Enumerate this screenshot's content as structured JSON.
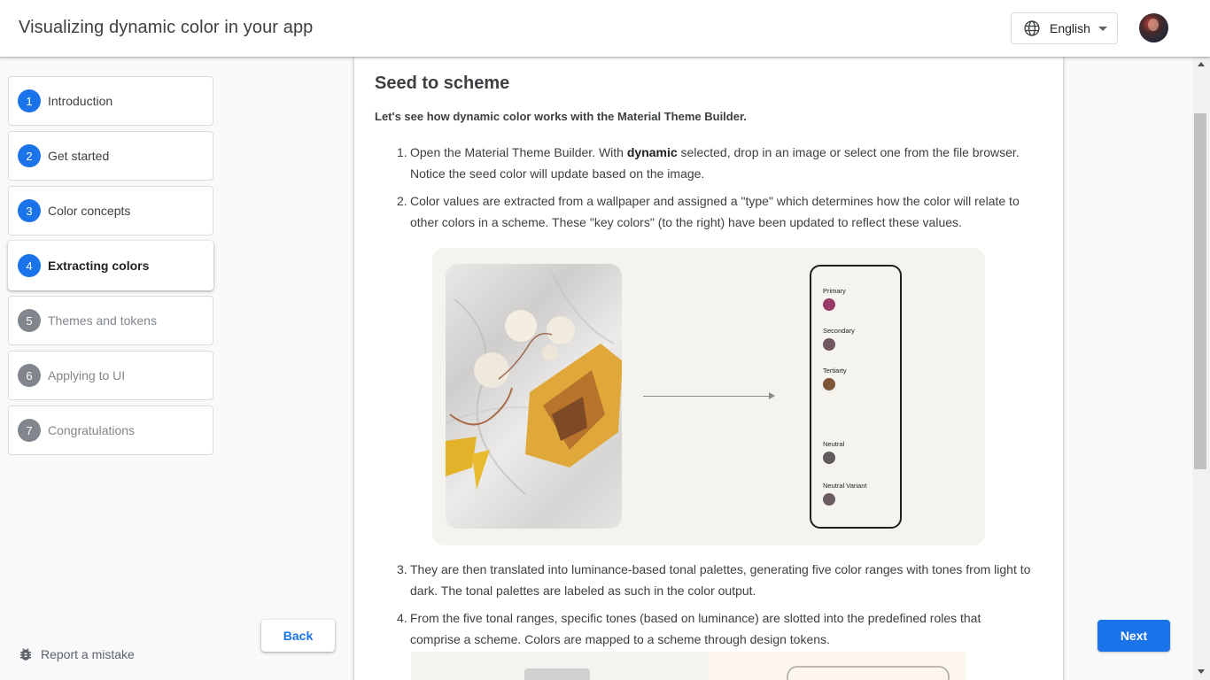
{
  "header": {
    "title": "Visualizing dynamic color in your app",
    "language": "English"
  },
  "steps": [
    {
      "num": "1",
      "label": "Introduction",
      "state": "done"
    },
    {
      "num": "2",
      "label": "Get started",
      "state": "done"
    },
    {
      "num": "3",
      "label": "Color concepts",
      "state": "done"
    },
    {
      "num": "4",
      "label": "Extracting colors",
      "state": "active"
    },
    {
      "num": "5",
      "label": "Themes and tokens",
      "state": "future"
    },
    {
      "num": "6",
      "label": "Applying to UI",
      "state": "future"
    },
    {
      "num": "7",
      "label": "Congratulations",
      "state": "future"
    }
  ],
  "footer": {
    "report": "Report a mistake",
    "back": "Back",
    "next": "Next"
  },
  "content": {
    "heading": "Seed to scheme",
    "intro": "Let's see how dynamic color works with the Material Theme Builder.",
    "items": [
      {
        "num": "1.",
        "pre": "Open the Material Theme Builder. With ",
        "bold": "dynamic",
        "post": " selected, drop in an image or select one from the file browser. Notice the seed color will update based on the image."
      },
      {
        "num": "2.",
        "text": "Color values are extracted from a wallpaper and assigned a \"type\" which determines how the color will relate to other colors in a scheme. These \"key colors\" (to the right) have been updated to reflect these values."
      },
      {
        "num": "3.",
        "text": "They are then translated into luminance-based tonal palettes, generating five color ranges with tones from light to dark. The tonal palettes are labeled as such in the color output."
      },
      {
        "num": "4.",
        "text": "From the five tonal ranges, specific tones (based on luminance) are slotted into the predefined roles that comprise a scheme. Colors are mapped to a scheme through design tokens."
      }
    ],
    "key_colors": [
      {
        "label": "Primary",
        "color": "#9b3a68"
      },
      {
        "label": "Secondary",
        "color": "#6f5861"
      },
      {
        "label": "Tertiarty",
        "color": "#7c5636"
      },
      {
        "label": "Neutral",
        "color": "#605a5c"
      },
      {
        "label": "Neutral Variant",
        "color": "#6b5b63"
      }
    ]
  },
  "colors": {
    "accent": "#1a73e8",
    "inactive_step": "#80868b"
  }
}
